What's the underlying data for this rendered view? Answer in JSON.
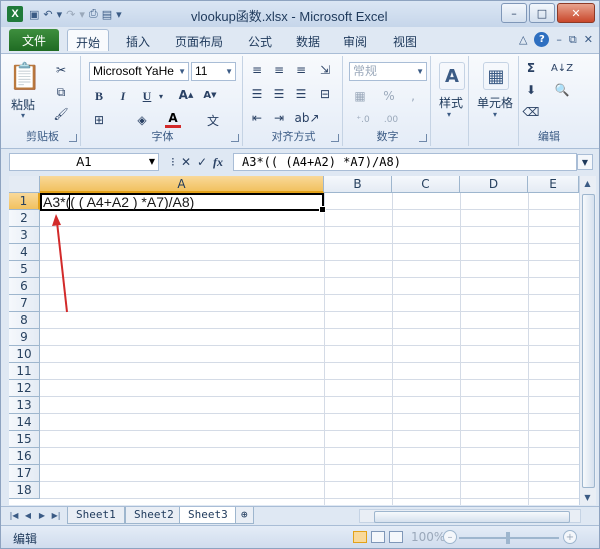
{
  "window": {
    "title": "vlookup函数.xlsx - Microsoft Excel",
    "app_icon_letter": "X",
    "controls": [
      "–",
      "□",
      "✕"
    ]
  },
  "tabs": {
    "file": "文件",
    "items": [
      "开始",
      "插入",
      "页面布局",
      "公式",
      "数据",
      "审阅",
      "视图"
    ],
    "active": "开始"
  },
  "ribbon": {
    "clipboard": {
      "label": "剪贴板",
      "paste": "粘贴"
    },
    "font": {
      "label": "字体",
      "name": "Microsoft YaHe",
      "size": "11",
      "bold": "B",
      "italic": "I",
      "underline": "U"
    },
    "alignment": {
      "label": "对齐方式"
    },
    "number": {
      "label": "数字",
      "format": "常规",
      "percent": "%"
    },
    "styles": {
      "label": "样式"
    },
    "cells": {
      "label": "单元格"
    },
    "editing": {
      "label": "编辑"
    }
  },
  "formula_bar": {
    "name_box": "A1",
    "fx": "fx",
    "formula": "A3*(( (A4+A2) *A7)/A8)"
  },
  "grid": {
    "columns": [
      "A",
      "B",
      "C",
      "D",
      "E"
    ],
    "rows": [
      "1",
      "2",
      "3",
      "4",
      "5",
      "6",
      "7",
      "8",
      "9",
      "10",
      "11",
      "12",
      "13",
      "14",
      "15",
      "16",
      "17",
      "18"
    ],
    "selected_cell": "A1",
    "cell_A1": "A3*(( ( A4+A2 ) *A7)/A8)"
  },
  "annotation": {
    "arrow_color": "#d22a2a"
  },
  "sheets": {
    "tabs": [
      "Sheet1",
      "Sheet2",
      "Sheet3"
    ],
    "active": "Sheet3"
  },
  "status": {
    "mode": "编辑",
    "zoom": "100%"
  }
}
